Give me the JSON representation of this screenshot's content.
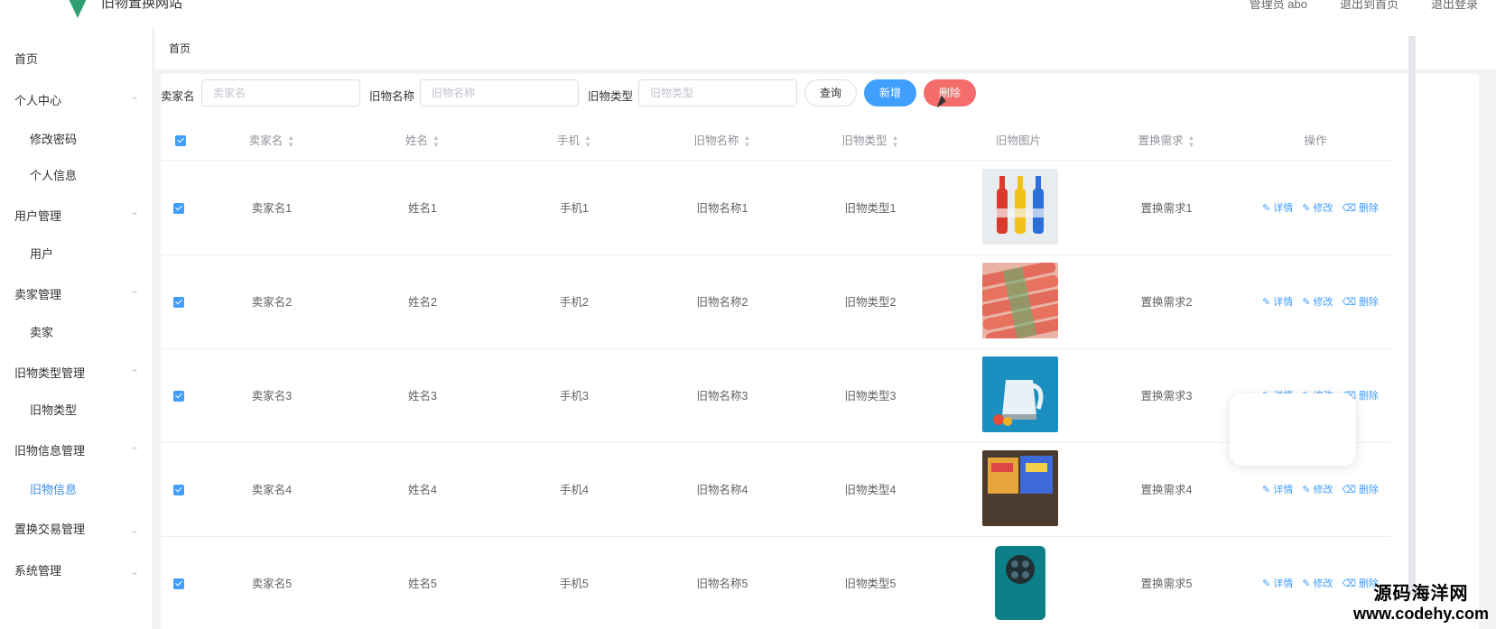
{
  "header": {
    "title": "旧物置换网站",
    "links": [
      "管理员 abo",
      "退出到首页",
      "退出登录"
    ]
  },
  "sidebar": {
    "items": [
      {
        "label": "首页",
        "type": "top",
        "chevron": ""
      },
      {
        "label": "个人中心",
        "type": "top",
        "chevron": "^"
      },
      {
        "label": "修改密码",
        "type": "sub",
        "chevron": ""
      },
      {
        "label": "个人信息",
        "type": "sub",
        "chevron": ""
      },
      {
        "label": "用户管理",
        "type": "top",
        "chevron": "^"
      },
      {
        "label": "用户",
        "type": "sub",
        "chevron": ""
      },
      {
        "label": "卖家管理",
        "type": "top",
        "chevron": "^"
      },
      {
        "label": "卖家",
        "type": "sub",
        "chevron": ""
      },
      {
        "label": "旧物类型管理",
        "type": "top",
        "chevron": "^"
      },
      {
        "label": "旧物类型",
        "type": "sub",
        "chevron": ""
      },
      {
        "label": "旧物信息管理",
        "type": "top",
        "chevron": "^"
      },
      {
        "label": "旧物信息",
        "type": "sub",
        "chevron": "",
        "active": true
      },
      {
        "label": "置换交易管理",
        "type": "top",
        "chevron": "v"
      },
      {
        "label": "系统管理",
        "type": "top",
        "chevron": "v"
      }
    ]
  },
  "breadcrumb": "首页",
  "search": {
    "seller_label": "卖家名",
    "seller_placeholder": "卖家名",
    "item_label": "旧物名称",
    "item_placeholder": "旧物名称",
    "type_label": "旧物类型",
    "type_placeholder": "旧物类型",
    "query_button": "查询",
    "add_button": "新增",
    "delete_button": "删除"
  },
  "table": {
    "columns": [
      "卖家名",
      "姓名",
      "手机",
      "旧物名称",
      "旧物类型",
      "旧物图片",
      "置换需求",
      "操作"
    ],
    "rows": [
      {
        "seller": "卖家名1",
        "name": "姓名1",
        "phone": "手机1",
        "item": "旧物名称1",
        "type": "旧物类型1",
        "req": "置换需求1",
        "img": "bottles"
      },
      {
        "seller": "卖家名2",
        "name": "姓名2",
        "phone": "手机2",
        "item": "旧物名称2",
        "type": "旧物类型2",
        "req": "置换需求2",
        "img": "sausages"
      },
      {
        "seller": "卖家名3",
        "name": "姓名3",
        "phone": "手机3",
        "item": "旧物名称3",
        "type": "旧物类型3",
        "req": "置换需求3",
        "img": "kettle"
      },
      {
        "seller": "卖家名4",
        "name": "姓名4",
        "phone": "手机4",
        "item": "旧物名称4",
        "type": "旧物类型4",
        "req": "置换需求4",
        "img": "snacks"
      },
      {
        "seller": "卖家名5",
        "name": "姓名5",
        "phone": "手机5",
        "item": "旧物名称5",
        "type": "旧物类型5",
        "req": "置换需求5",
        "img": "phone"
      }
    ],
    "ops": {
      "detail": "详情",
      "edit": "修改",
      "delete": "删除"
    }
  },
  "watermark": {
    "line1": "源码海洋网",
    "line2": "www.codehy.com"
  },
  "colors": {
    "primary": "#409eff",
    "danger": "#f56c6c",
    "logo": "#2f9f73"
  }
}
